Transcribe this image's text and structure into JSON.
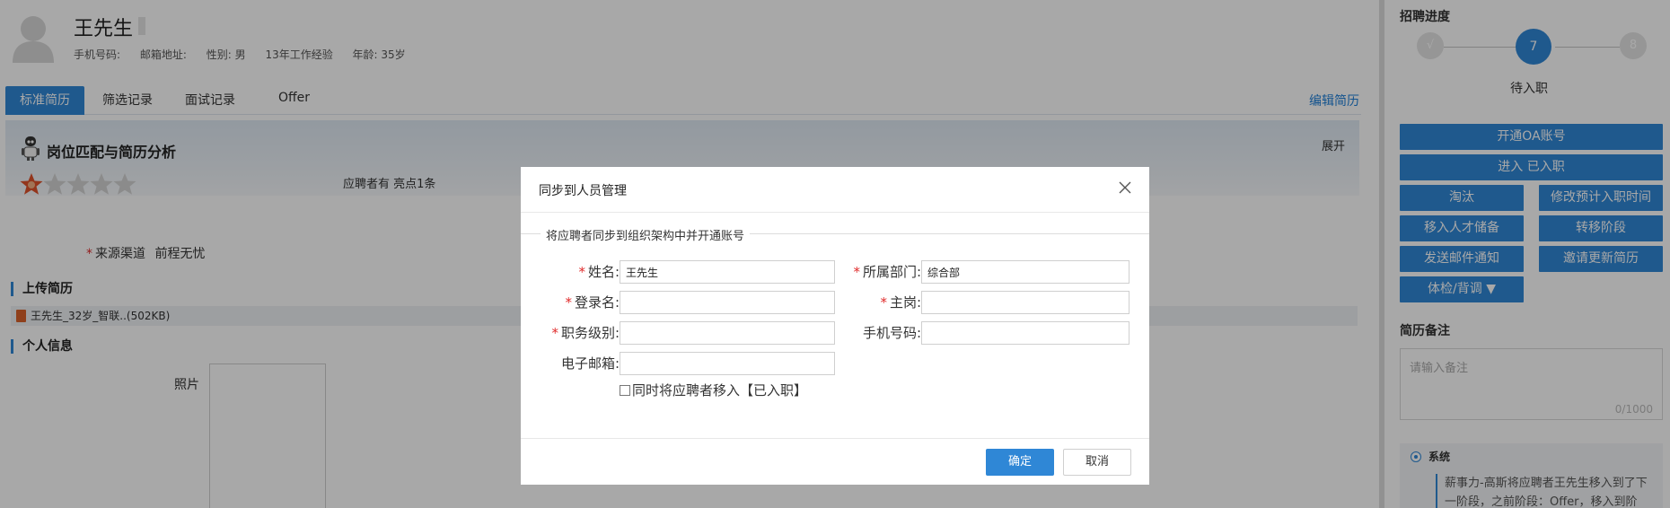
{
  "candidate": {
    "name": "王先生",
    "meta": [
      "手机号码:",
      "邮箱地址:",
      "性别: 男",
      "13年工作经验",
      "年龄: 35岁"
    ]
  },
  "tabs": [
    "标准简历",
    "筛选记录",
    "面试记录",
    "Offer"
  ],
  "edit_link": "编辑简历",
  "analysis": {
    "title": "岗位匹配与简历分析",
    "expand": "展开",
    "rating": 1,
    "rating_max": 5,
    "highlights": "应聘者有 亮点1条"
  },
  "source": {
    "label": "来源渠道",
    "value": "前程无忧"
  },
  "upload": {
    "title": "上传简历",
    "file": "王先生_32岁_智联..(502KB)"
  },
  "personal": {
    "title": "个人信息",
    "photo_label": "照片"
  },
  "progress": {
    "title": "招聘进度",
    "steps": [
      {
        "label": "√",
        "state": "done"
      },
      {
        "label": "7",
        "state": "current"
      },
      {
        "label": "8",
        "state": "todo"
      }
    ],
    "current_label": "待入职"
  },
  "actions": {
    "open_oa": "开通OA账号",
    "enter_onboarded": "进入 已入职",
    "eliminate": "淘汰",
    "modify_onboard_time": "修改预计入职时间",
    "move_talent_pool": "移入人才储备",
    "transfer_stage": "转移阶段",
    "send_email": "发送邮件通知",
    "invite_update": "邀请更新简历",
    "checkup": "体检/背调 ▼"
  },
  "notes": {
    "title": "简历备注",
    "placeholder": "请输入备注",
    "count": "0/1000"
  },
  "log": {
    "tag": "系统",
    "text": "薪事力-高斯将应聘者王先生移入到了下一阶段，之前阶段：Offer，移入到阶"
  },
  "modal": {
    "title": "同步到人员管理",
    "legend": "将应聘者同步到组织架构中并开通账号",
    "fields": {
      "name": {
        "label": "姓名:",
        "value": ""
      },
      "dept": {
        "label": "所属部门:",
        "value": ""
      },
      "login": {
        "label": "登录名:",
        "value": ""
      },
      "post": {
        "label": "主岗:",
        "value": ""
      },
      "rank": {
        "label": "职务级别:",
        "value": ""
      },
      "phone": {
        "label": "手机号码:",
        "value": ""
      },
      "email": {
        "label": "电子邮箱:",
        "value": ""
      }
    },
    "name_value": "王先生",
    "dept_value": "综合部",
    "checkbox_label": "同时将应聘者移入【已入职】",
    "ok": "确定",
    "cancel": "取消"
  },
  "colors": {
    "primary": "#2f87d6",
    "required": "#e02b2b",
    "star_active": "#e0522b"
  }
}
